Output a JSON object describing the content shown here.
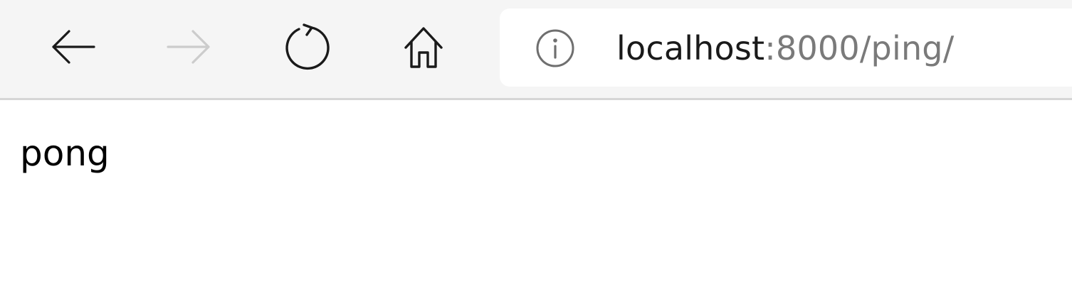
{
  "browser": {
    "toolbar": {
      "back_icon": "arrow-left-icon",
      "forward_icon": "arrow-right-icon",
      "reload_icon": "reload-icon",
      "home_icon": "home-icon",
      "forward_enabled": false
    },
    "address_bar": {
      "info_icon": "info-icon",
      "host": "localhost",
      "rest": ":8000/ping/"
    }
  },
  "page": {
    "body_text": "pong"
  },
  "colors": {
    "toolbar_bg": "#f5f5f5",
    "url_host": "#1a1a1a",
    "url_rest": "#7a7a7a",
    "disabled_icon": "#cccccc"
  }
}
